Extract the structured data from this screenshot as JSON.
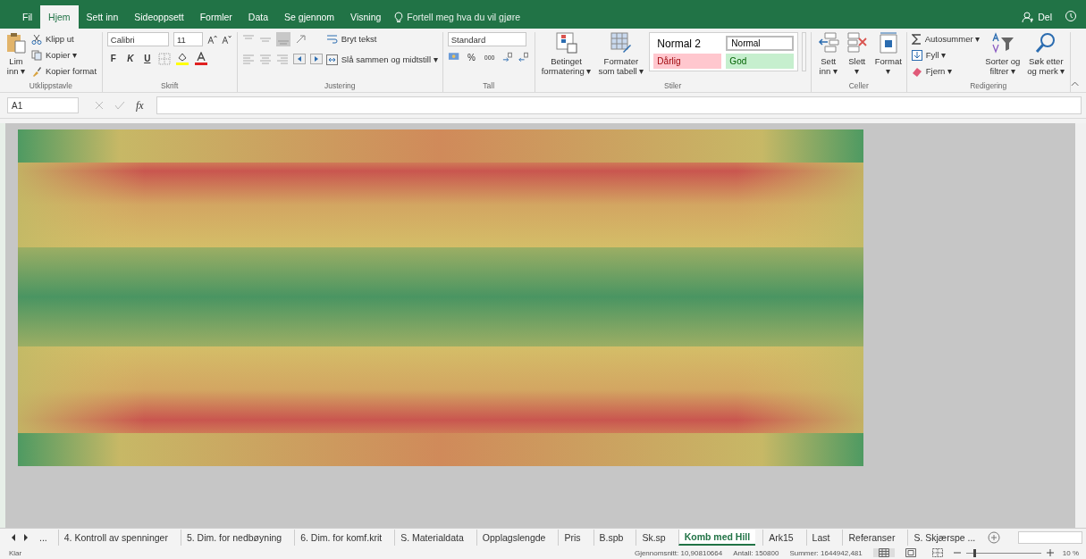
{
  "tabs": [
    {
      "label": "Fil",
      "selected": false
    },
    {
      "label": "Hjem",
      "selected": true
    },
    {
      "label": "Sett inn",
      "selected": false
    },
    {
      "label": "Sideoppsett",
      "selected": false
    },
    {
      "label": "Formler",
      "selected": false
    },
    {
      "label": "Data",
      "selected": false
    },
    {
      "label": "Se gjennom",
      "selected": false
    },
    {
      "label": "Visning",
      "selected": false
    }
  ],
  "tell_me": "Fortell meg hva du vil gjøre",
  "share": "Del",
  "clipboard": {
    "paste": [
      "Lim",
      "inn ▾"
    ],
    "cut": "Klipp ut",
    "copy": "Kopier ▾",
    "format_painter": "Kopier format",
    "label": "Utklippstavle"
  },
  "font": {
    "name": "Calibri",
    "size": "11",
    "bold": "F",
    "italic": "K",
    "underline": "U",
    "label": "Skrift"
  },
  "alignment": {
    "wrap": "Bryt tekst",
    "merge": "Slå sammen og midtstill ▾",
    "label": "Justering"
  },
  "number": {
    "format": "Standard",
    "percent": "%",
    "thousands": "000",
    "label": "Tall"
  },
  "styles": {
    "conditional": [
      "Betinget",
      "formatering ▾"
    ],
    "as_table": [
      "Formater",
      "som tabell ▾"
    ],
    "label": "Stiler",
    "gallery": [
      {
        "label": "Normal 2",
        "kind": "plain"
      },
      {
        "label": "Normal",
        "kind": "framed"
      },
      {
        "label": "Dårlig",
        "kind": "bad"
      },
      {
        "label": "God",
        "kind": "good"
      }
    ]
  },
  "cells": {
    "buttons": [
      [
        "Sett",
        "inn ▾"
      ],
      [
        "Slett",
        "▾"
      ],
      [
        "Format",
        "▾"
      ]
    ],
    "label": "Celler"
  },
  "editing": {
    "autosum": "Autosummer ▾",
    "fill": "Fyll ▾",
    "clear": "Fjern ▾",
    "sort": [
      "Sorter og",
      "filtrer ▾"
    ],
    "find": [
      "Søk etter",
      "og merk ▾"
    ],
    "label": "Redigering"
  },
  "formula_bar": {
    "name_box": "A1",
    "fx": "fx"
  },
  "sheet_nav": "...",
  "sheet_tabs": [
    {
      "label": "4. Kontroll av spenninger",
      "selected": false
    },
    {
      "label": "5. Dim. for nedbøyning",
      "selected": false
    },
    {
      "label": "6. Dim. for komf.krit",
      "selected": false
    },
    {
      "label": "S. Materialdata",
      "selected": false
    },
    {
      "label": "Opplagslengde",
      "selected": false
    },
    {
      "label": "Pris",
      "selected": false
    },
    {
      "label": "B.spb",
      "selected": false
    },
    {
      "label": "Sk.sp",
      "selected": false
    },
    {
      "label": "Komb med Hill",
      "selected": true
    },
    {
      "label": "Ark15",
      "selected": false
    },
    {
      "label": "Last",
      "selected": false
    },
    {
      "label": "Referanser",
      "selected": false
    },
    {
      "label": "S. Skjærspe ...",
      "selected": false
    }
  ],
  "status": {
    "mode": "Klar",
    "average": "Gjennomsnitt: 10,90810664",
    "count": "Antall: 150800",
    "sum": "Summer: 1644942,481",
    "zoom": "10 %"
  },
  "zoom_slider": {
    "level": 0.1
  }
}
